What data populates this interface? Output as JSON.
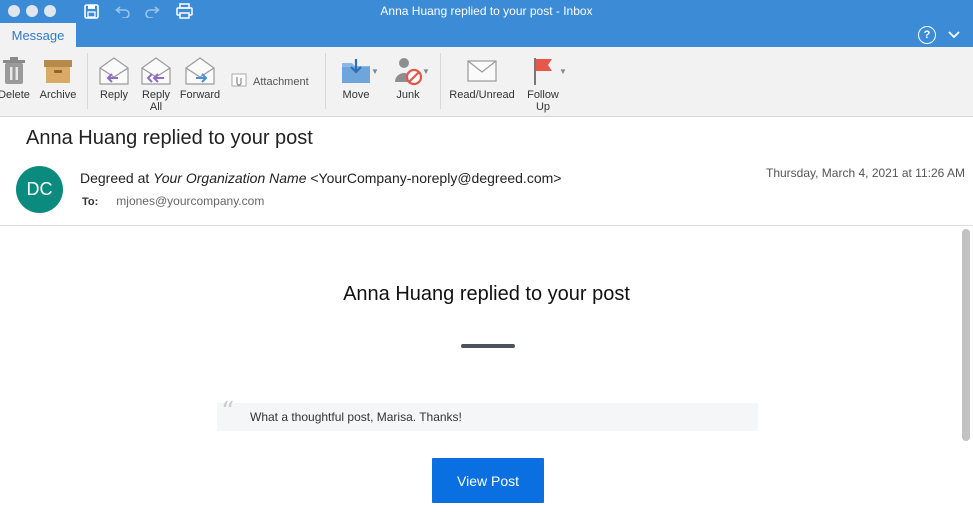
{
  "window": {
    "title": "Anna Huang replied to your post - Inbox"
  },
  "tabs": {
    "message": "Message",
    "help_symbol": "?"
  },
  "ribbon": {
    "delete": "Delete",
    "archive": "Archive",
    "reply": "Reply",
    "reply_all_1": "Reply",
    "reply_all_2": "All",
    "forward": "Forward",
    "attachment": "Attachment",
    "move": "Move",
    "junk": "Junk",
    "read_unread": "Read/Unread",
    "follow_up_1": "Follow",
    "follow_up_2": "Up",
    "icons": [
      "trash-icon",
      "archive-box-icon",
      "reply-icon",
      "reply-all-icon",
      "forward-icon",
      "paperclip-icon",
      "move-folder-icon",
      "junk-icon",
      "envelope-icon",
      "flag-icon"
    ]
  },
  "header": {
    "subject": "Anna Huang replied to your post",
    "avatar_initials": "DC",
    "avatar_color": "#0b8a7e",
    "from_sender": "Degreed at ",
    "from_org": "Your Organization Name",
    "from_email": " <YourCompany-noreply@degreed.com>",
    "to_label": "To:",
    "to_value": "mjones@yourcompany.com",
    "date": "Thursday, March 4, 2021 at 11:26 AM"
  },
  "email": {
    "heading": "Anna Huang replied to your post",
    "quote_mark": "“",
    "quote": "What a thoughtful post, Marisa. Thanks!",
    "button_label": "View Post",
    "button_color": "#0a6fe0"
  },
  "colors": {
    "titlebar": "#3c8bd6",
    "accent": "#2f7ac7"
  }
}
